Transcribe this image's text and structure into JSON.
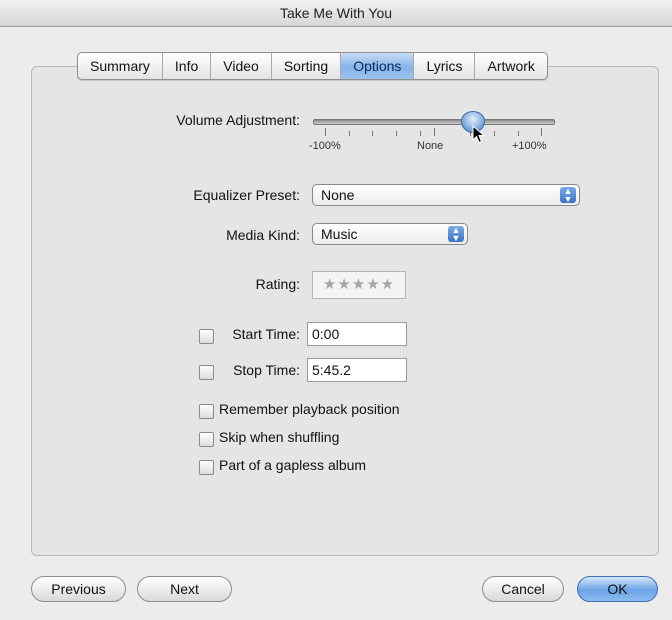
{
  "window": {
    "title": "Take Me With You"
  },
  "tabs": [
    {
      "label": "Summary",
      "active": false
    },
    {
      "label": "Info",
      "active": false
    },
    {
      "label": "Video",
      "active": false
    },
    {
      "label": "Sorting",
      "active": false
    },
    {
      "label": "Options",
      "active": true
    },
    {
      "label": "Lyrics",
      "active": false
    },
    {
      "label": "Artwork",
      "active": false
    }
  ],
  "options": {
    "volume": {
      "label": "Volume Adjustment:",
      "min_label": "-100%",
      "mid_label": "None",
      "max_label": "+100%",
      "value_fraction": 0.66
    },
    "equalizer": {
      "label": "Equalizer Preset:",
      "value": "None"
    },
    "media_kind": {
      "label": "Media Kind:",
      "value": "Music"
    },
    "rating": {
      "label": "Rating:",
      "stars": "★★★★★",
      "value": 0
    },
    "start_time": {
      "label": "Start Time:",
      "value": "0:00",
      "checked": false
    },
    "stop_time": {
      "label": "Stop Time:",
      "value": "5:45.2",
      "checked": false
    },
    "remember_playback": {
      "label": "Remember playback position",
      "checked": false
    },
    "skip_shuffling": {
      "label": "Skip when shuffling",
      "checked": false
    },
    "gapless": {
      "label": "Part of a gapless album",
      "checked": false
    }
  },
  "buttons": {
    "previous": "Previous",
    "next": "Next",
    "cancel": "Cancel",
    "ok": "OK"
  },
  "colors": {
    "accent": "#6aa3e6",
    "active_tab": "#86b4ea",
    "window_bg": "#ececec"
  },
  "icons": {
    "popup_arrows": "up-down-arrows-icon",
    "cursor": "mouse-pointer-icon"
  }
}
